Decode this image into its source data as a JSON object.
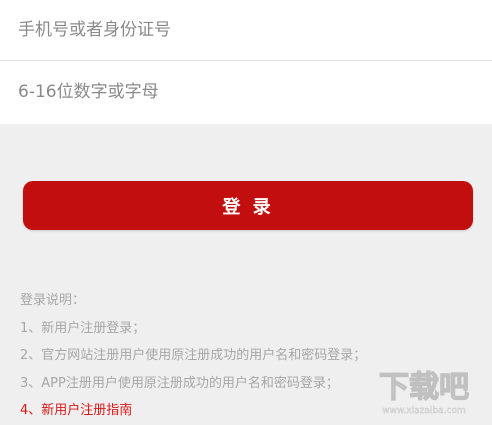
{
  "form": {
    "username_placeholder": "手机号或者身份证号",
    "password_placeholder": "6-16位数字或字母"
  },
  "login_button": {
    "label": "登 录"
  },
  "notes": {
    "title": "登录说明：",
    "items": [
      "1、新用户注册登录；",
      "2、官方网站注册用户使用原注册成功的用户名和密码登录；",
      "3、APP注册用户使用原注册成功的用户名和密码登录；",
      "4、新用户注册指南"
    ]
  },
  "watermark": {
    "text": "下载吧",
    "sub": "www.xiazaiba.com"
  },
  "colors": {
    "accent": "#c20e0e",
    "link": "#d71818",
    "background": "#efefef"
  }
}
